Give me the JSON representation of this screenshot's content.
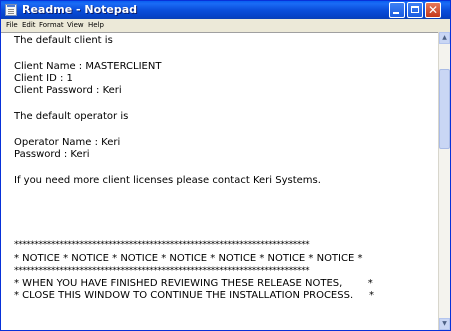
{
  "window": {
    "title": "Readme - Notepad",
    "close_glyph": "✕",
    "accent_color": "#0a5ff0"
  },
  "menu": {
    "items": [
      "File",
      "Edit",
      "Format",
      "View",
      "Help"
    ]
  },
  "document": {
    "lines": [
      "The default client is",
      "Client Name : MASTERCLIENT",
      "Client ID : 1",
      "Client Password : Keri",
      "The default operator is",
      "Operator Name : Keri",
      "Password : Keri",
      "If you need more client licenses please contact Keri Systems.",
      "************************************************************************",
      "* NOTICE * NOTICE * NOTICE * NOTICE * NOTICE * NOTICE * NOTICE *",
      "************************************************************************",
      "* WHEN YOU HAVE FINISHED REVIEWING THESE RELEASE NOTES,        *",
      "* CLOSE THIS WINDOW TO CONTINUE THE INSTALLATION PROCESS.     *"
    ]
  },
  "scrollbar": {
    "up_glyph": "▲",
    "down_glyph": "▼"
  }
}
